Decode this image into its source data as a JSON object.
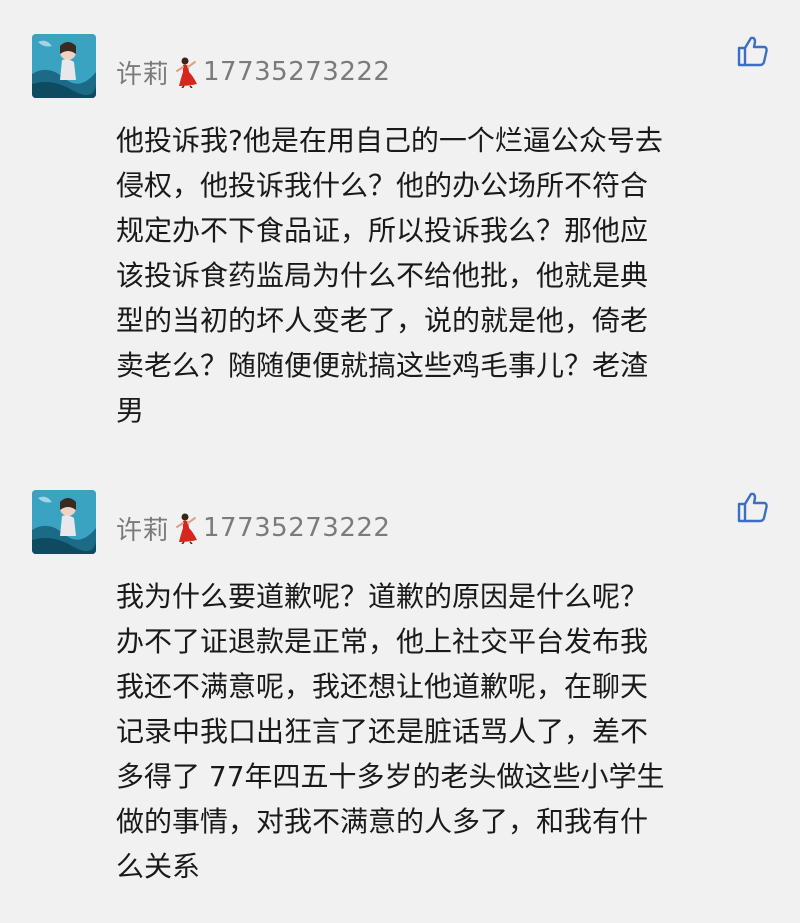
{
  "comments": [
    {
      "username": "许莉",
      "user_id": "17735273222",
      "emoji_icon": "dancer-icon",
      "lines": [
        "他投诉我?他是在用自己的一个烂逼公众号去",
        "侵权，他投诉我什么？他的办公场所不符合",
        "规定办不下食品证，所以投诉我么？那他应",
        "该投诉食药监局为什么不给他批，他就是典",
        "型的当初的坏人变老了，说的就是他，倚老",
        "卖老么？随随便便就搞这些鸡毛事儿？老渣",
        "男"
      ]
    },
    {
      "username": "许莉",
      "user_id": "17735273222",
      "emoji_icon": "dancer-icon",
      "lines": [
        "我为什么要道歉呢？道歉的原因是什么呢？",
        "办不了证退款是正常，他上社交平台发布我",
        "我还不满意呢，我还想让他道歉呢，在聊天",
        "记录中我口出狂言了还是脏话骂人了，差不",
        "多得了 77年四五十多岁的老头做这些小学生",
        "做的事情，对我不满意的人多了，和我有什",
        "么关系"
      ]
    }
  ],
  "colors": {
    "background": "#f1f1f1",
    "name": "#7b7b7b",
    "text": "#1a1a1a",
    "like_icon": "#3a6fc4"
  }
}
